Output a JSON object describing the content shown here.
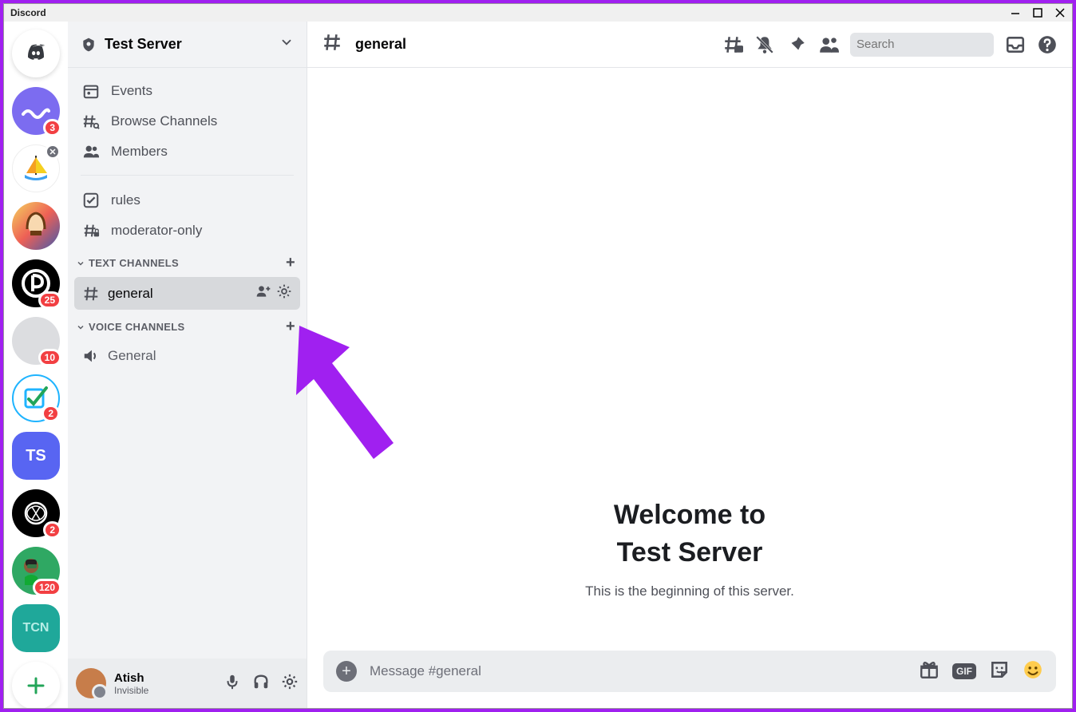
{
  "titlebar": {
    "app_name": "Discord"
  },
  "rail": {
    "badges": {
      "s1": "3",
      "s4": "25",
      "s5": "10",
      "s6": "2",
      "s7": "2",
      "s8": "120"
    }
  },
  "server": {
    "name": "Test Server"
  },
  "side": {
    "events": "Events",
    "browse": "Browse Channels",
    "members": "Members",
    "rules": "rules",
    "mod_only": "moderator-only"
  },
  "categories": {
    "text_label": "TEXT CHANNELS",
    "voice_label": "VOICE CHANNELS",
    "general": "general",
    "voice_general": "General"
  },
  "user": {
    "name": "Atish",
    "status": "Invisible"
  },
  "header": {
    "channel": "general",
    "search_placeholder": "Search"
  },
  "welcome": {
    "line1": "Welcome to",
    "line2": "Test Server",
    "sub": "This is the beginning of this server."
  },
  "composer": {
    "placeholder": "Message #general",
    "gif": "GIF"
  }
}
